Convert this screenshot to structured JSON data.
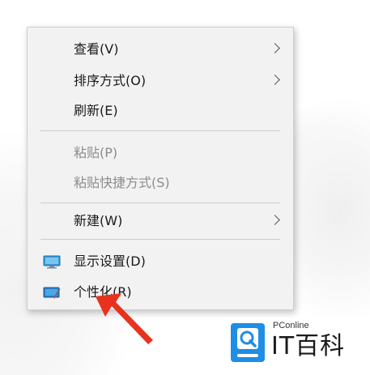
{
  "context_menu": {
    "items": [
      {
        "label": "查看(V)",
        "has_submenu": true,
        "disabled": false
      },
      {
        "label": "排序方式(O)",
        "has_submenu": true,
        "disabled": false
      },
      {
        "label": "刷新(E)",
        "has_submenu": false,
        "disabled": false
      },
      {
        "label": "粘贴(P)",
        "has_submenu": false,
        "disabled": true
      },
      {
        "label": "粘贴快捷方式(S)",
        "has_submenu": false,
        "disabled": true
      },
      {
        "label": "新建(W)",
        "has_submenu": true,
        "disabled": false
      },
      {
        "label": "显示设置(D)",
        "has_submenu": false,
        "disabled": false,
        "icon": "display-settings-icon"
      },
      {
        "label": "个性化(R)",
        "has_submenu": false,
        "disabled": false,
        "icon": "personalize-icon"
      }
    ]
  },
  "watermark": {
    "site": "PConline",
    "name": "IT百科",
    "logo_icon": "pconline-logo-icon",
    "color": "#1e8ee6"
  },
  "annotation": {
    "arrow_color": "#e8321e",
    "points_to": "个性化(R)"
  }
}
